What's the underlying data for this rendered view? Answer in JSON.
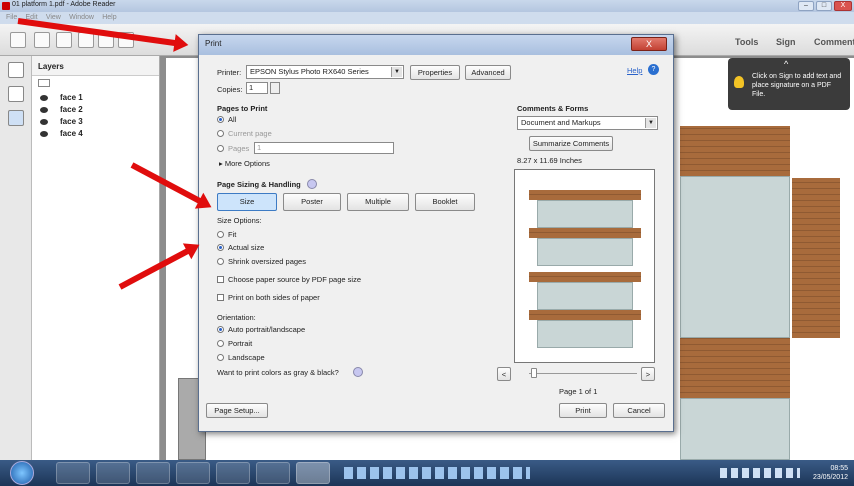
{
  "window": {
    "title": "01 platform 1.pdf - Adobe Reader",
    "min": "–",
    "max": "□",
    "close": "X"
  },
  "menu": [
    "File",
    "Edit",
    "View",
    "Window",
    "Help"
  ],
  "toolbar": {
    "tools": "Tools",
    "sign": "Sign",
    "comment": "Comment"
  },
  "sign_tip": "Click on Sign to add text and place signature on a PDF File.",
  "layers": {
    "title": "Layers",
    "items": [
      "face 1",
      "face 2",
      "face 3",
      "face 4"
    ]
  },
  "dialog": {
    "title": "Print",
    "close": "X",
    "printer_label": "Printer:",
    "printer_value": "EPSON Stylus Photo RX640 Series",
    "properties": "Properties",
    "advanced": "Advanced",
    "help": "Help",
    "copies_label": "Copies:",
    "copies_value": "1",
    "pages_title": "Pages to Print",
    "all": "All",
    "current_page": "Current page",
    "pages": "Pages",
    "pages_value": "1",
    "more_options": "More Options",
    "sizing_title": "Page Sizing & Handling",
    "size": "Size",
    "poster": "Poster",
    "multiple": "Multiple",
    "booklet": "Booklet",
    "size_options": "Size Options:",
    "fit": "Fit",
    "actual_size": "Actual size",
    "shrink": "Shrink oversized pages",
    "choose_source": "Choose paper source by PDF page size",
    "both_sides": "Print on both sides of paper",
    "orientation": "Orientation:",
    "auto": "Auto portrait/landscape",
    "portrait": "Portrait",
    "landscape": "Landscape",
    "gray": "Want to print colors as gray & black?",
    "comments_title": "Comments & Forms",
    "comments_value": "Document and Markups",
    "summarize": "Summarize Comments",
    "paper_size": "8.27 x 11.69 Inches",
    "nav_prev": "<",
    "nav_next": ">",
    "page_of": "Page 1 of 1",
    "page_setup": "Page Setup...",
    "print": "Print",
    "cancel": "Cancel"
  },
  "taskbar": {
    "time": "08:55",
    "date": "23/05/2012"
  },
  "colors": {
    "arrow": "#e00d0d",
    "brick": "#a86b3c",
    "taskbar": "#1c3557"
  }
}
